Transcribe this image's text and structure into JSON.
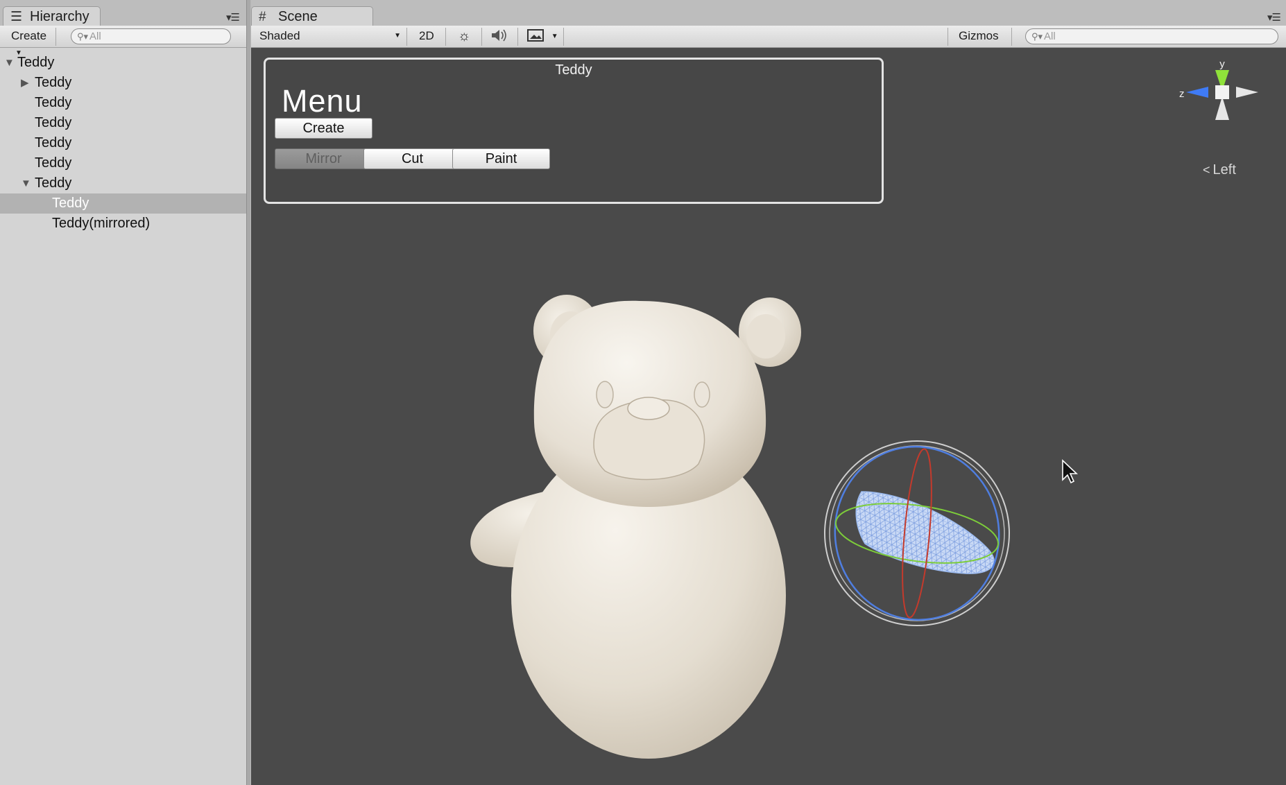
{
  "hierarchy": {
    "tab_label": "Hierarchy",
    "tab_icon": "list-icon",
    "create_label": "Create",
    "search_placeholder": "All",
    "items": [
      {
        "label": "Teddy",
        "expanded": true,
        "indent": 0
      },
      {
        "label": "Teddy",
        "expanded": false,
        "indent": 1
      },
      {
        "label": "Teddy",
        "indent": 1
      },
      {
        "label": "Teddy",
        "indent": 1
      },
      {
        "label": "Teddy",
        "indent": 1
      },
      {
        "label": "Teddy",
        "indent": 1
      },
      {
        "label": "Teddy",
        "expanded": true,
        "indent": 1
      },
      {
        "label": "Teddy",
        "indent": 2,
        "selected": true
      },
      {
        "label": "Teddy(mirrored)",
        "indent": 2
      }
    ]
  },
  "scene": {
    "tab_label": "Scene",
    "tab_icon": "grid-icon",
    "shading_mode": "Shaded",
    "mode_2d_label": "2D",
    "gizmos_label": "Gizmos",
    "search_placeholder": "All",
    "view_label": "Left"
  },
  "gui_window": {
    "title": "Teddy",
    "heading": "Menu",
    "buttons": {
      "create": "Create",
      "mirror": "Mirror",
      "cut": "Cut",
      "paint": "Paint"
    }
  },
  "gizmo_axes": {
    "y": "y",
    "z": "z"
  },
  "colors": {
    "viewport_bg": "#4a4a4a",
    "axis_y": "#8fe13a",
    "axis_z": "#3f7bf5",
    "axis_x_ring": "#cc3a2a",
    "selection_mesh": "#b8d4ff"
  }
}
